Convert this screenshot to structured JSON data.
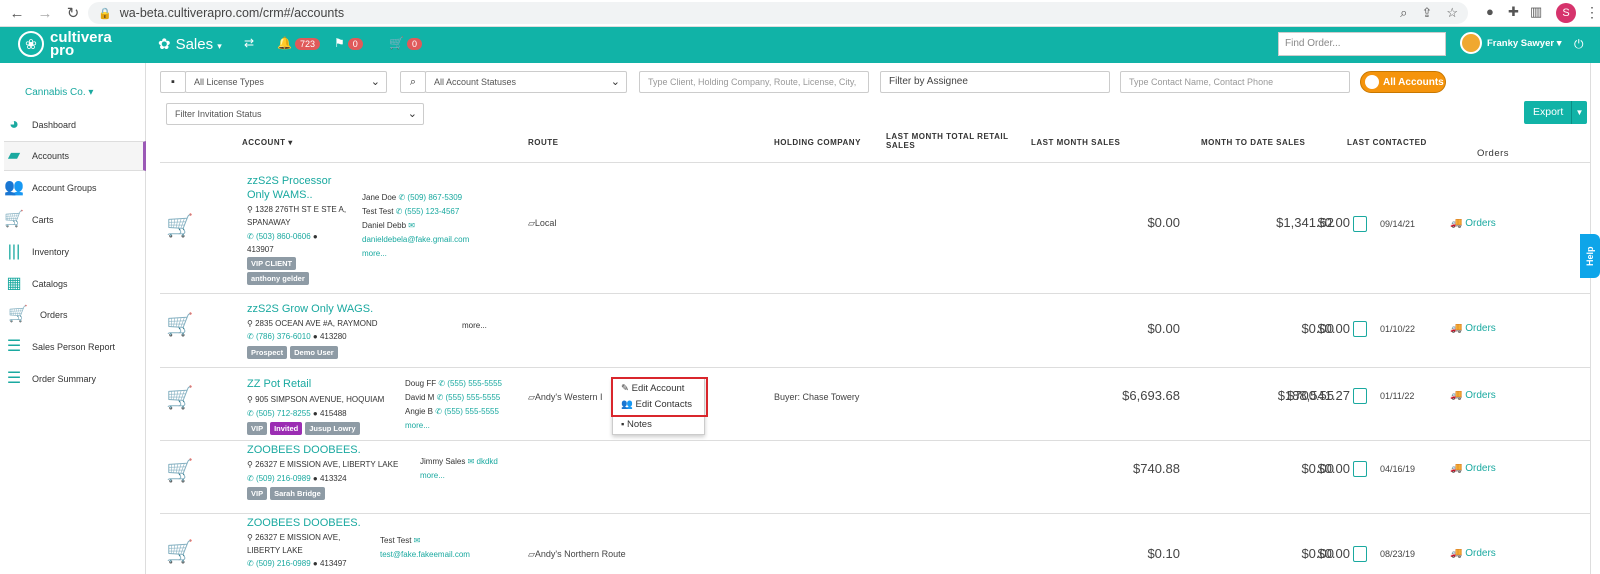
{
  "browser": {
    "url": "wa-beta.cultiverapro.com/crm#/accounts",
    "profile_initial": "S"
  },
  "app": {
    "logo_line1": "cultivera",
    "logo_line2": "pro",
    "module": "Sales",
    "notif_count": "723",
    "flag_count": "0",
    "cart_count": "0",
    "find_order_placeholder": "Find Order...",
    "user_name": "Franky Sawyer"
  },
  "sidebar": {
    "company": "Cannabis Co.",
    "items": [
      {
        "label": "Dashboard"
      },
      {
        "label": "Accounts"
      },
      {
        "label": "Account Groups"
      },
      {
        "label": "Carts"
      },
      {
        "label": "Inventory"
      },
      {
        "label": "Catalogs"
      },
      {
        "label": "Orders"
      },
      {
        "label": "Sales Person Report"
      },
      {
        "label": "Order Summary"
      }
    ]
  },
  "filters": {
    "license_types": "All License Types",
    "account_statuses": "All Account Statuses",
    "search_placeholder": "Type Client, Holding Company, Route, License, City,",
    "assignee_placeholder": "Filter by Assignee",
    "contact_placeholder": "Type Contact Name, Contact Phone",
    "all_accounts": "All Accounts",
    "invitation_status": "Filter Invitation Status",
    "export": "Export"
  },
  "table": {
    "headers": {
      "account": "ACCOUNT ▾",
      "route": "ROUTE",
      "holding": "HOLDING COMPANY",
      "lm_retail_1": "LAST MONTH TOTAL RETAIL",
      "lm_retail_2": "SALES",
      "lm_sales": "LAST MONTH SALES",
      "mtd": "MONTH TO DATE SALES",
      "contacted": "LAST CONTACTED",
      "orders": "Orders"
    },
    "rows": [
      {
        "name1": "zzS2S Processor",
        "name2": "Only WAMS..",
        "addr1": "1328 276TH ST E STE A,",
        "addr2": "SPANAWAY",
        "phone": "(503) 860-0606",
        "license": "413907",
        "tags": [
          "VIP CLIENT",
          "anthony gelder"
        ],
        "contacts": [
          {
            "name": "Jane Doe",
            "phone": "(509) 867-5309"
          },
          {
            "name": "Test Test",
            "phone": "(555) 123-4567"
          },
          {
            "name": "Daniel Debb",
            "phone": ""
          },
          {
            "name": "",
            "phone": "danieldebela@fake.gmail.com"
          }
        ],
        "more": "more...",
        "route": "Local",
        "holding": "",
        "lm_retail": "$0.00",
        "lm_sales": "$0.00",
        "mtd": "$1,341.62",
        "date": "09/14/21",
        "orders": "Orders"
      },
      {
        "name1": "zzS2S Grow Only WAGS.",
        "addr1": "2835 OCEAN AVE #A, RAYMOND",
        "phone": "(786) 376-6010",
        "license": "413280",
        "tags": [
          "Prospect",
          "Demo User"
        ],
        "more": "more...",
        "route": "",
        "holding": "",
        "lm_retail": "$0.00",
        "lm_sales": "$0.00",
        "mtd": "$0.00",
        "date": "01/10/22",
        "orders": "Orders"
      },
      {
        "name1": "ZZ Pot Retail",
        "addr1": "905 SIMPSON AVENUE, HOQUIAM",
        "phone": "(505) 712-8255",
        "license": "415488",
        "tags": [
          "VIP",
          "Invited",
          "Jusup Lowry"
        ],
        "contacts": [
          {
            "name": "Doug FF",
            "phone": "(555) 555-5555"
          },
          {
            "name": "David M",
            "phone": "(555) 555-5555"
          },
          {
            "name": "Angie B",
            "phone": "(555) 555-5555"
          }
        ],
        "more": "more...",
        "route": "Andy's Western I",
        "holding": "Buyer: Chase Towery",
        "lm_retail": "$6,693.68",
        "lm_sales": "$188,541.27",
        "mtd": "$700.55",
        "date": "01/11/22",
        "orders": "Orders"
      },
      {
        "name1": "ZOOBEES DOOBEES.",
        "addr1": "26327 E MISSION AVE, LIBERTY LAKE",
        "phone": "(509) 216-0989",
        "license": "413324",
        "tags": [
          "VIP",
          "Sarah Bridge"
        ],
        "contacts": [
          {
            "name": "Jimmy Sales",
            "phone": "dkdkd"
          }
        ],
        "more": "more...",
        "route": "",
        "holding": "",
        "lm_retail": "$740.88",
        "lm_sales": "$0.00",
        "mtd": "$0.00",
        "date": "04/16/19",
        "orders": "Orders"
      },
      {
        "name1": "ZOOBEES DOOBEES.",
        "addr1": "26327 E MISSION AVE,",
        "addr2": "LIBERTY LAKE",
        "phone": "(509) 216-0989",
        "license": "413497",
        "contacts": [
          {
            "name": "Test Test",
            "phone": ""
          },
          {
            "name": "",
            "phone": "test@fake.fakeemail.com"
          }
        ],
        "route": "Andy's Northern Route",
        "holding": "",
        "lm_retail": "$0.10",
        "lm_sales": "$0.00",
        "mtd": "$0.00",
        "date": "08/23/19",
        "orders": "Orders"
      }
    ]
  },
  "context_menu": {
    "edit_account": "Edit Account",
    "edit_contacts": "Edit Contacts",
    "notes": "Notes"
  },
  "help": "Help",
  "colors": {
    "brand": "#11b3a7",
    "accent_orange": "#f5940c",
    "highlight_red": "#d9262c"
  }
}
